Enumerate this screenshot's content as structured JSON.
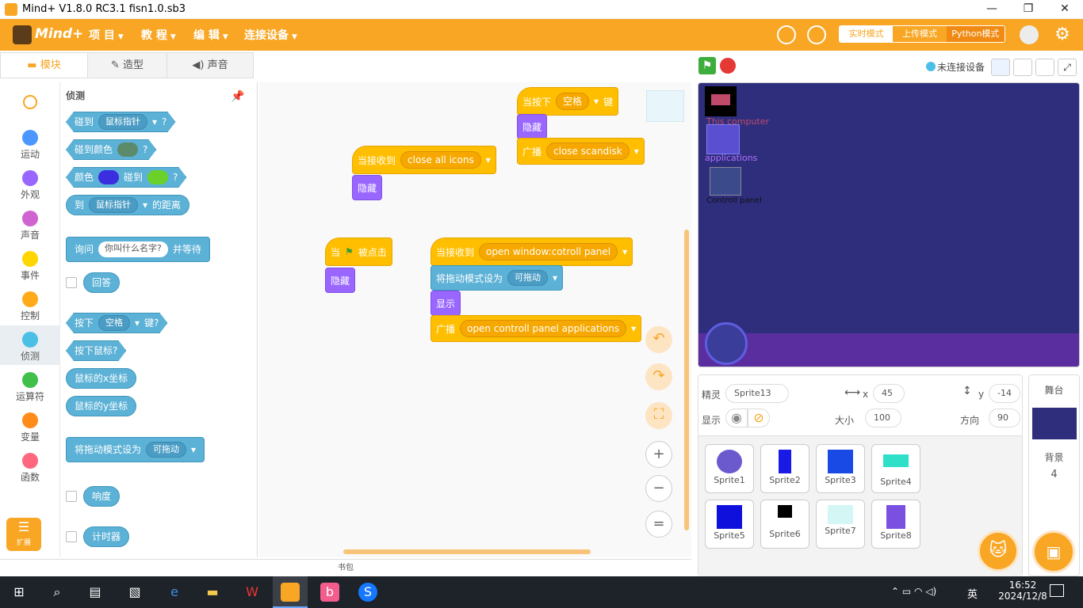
{
  "window": {
    "title": "Mind+ V1.8.0 RC3.1    fisn1.0.sb3",
    "minimize": "—",
    "restore": "❐",
    "close": "✕"
  },
  "menu": {
    "logo": "Mind+",
    "items": [
      "项 目",
      "教 程",
      "编 辑",
      "连接设备"
    ],
    "modes": [
      "实时模式",
      "上传模式",
      "Python模式"
    ]
  },
  "tabs": [
    "模块",
    "造型",
    "声音"
  ],
  "categories": [
    {
      "label": "运动",
      "color": "#4c97ff"
    },
    {
      "label": "外观",
      "color": "#9966ff"
    },
    {
      "label": "声音",
      "color": "#cf63cf"
    },
    {
      "label": "事件",
      "color": "#ffd500"
    },
    {
      "label": "控制",
      "color": "#ffab19"
    },
    {
      "label": "侦测",
      "color": "#4cbfe6"
    },
    {
      "label": "运算符",
      "color": "#40bf4a"
    },
    {
      "label": "变量",
      "color": "#ff8c1a"
    },
    {
      "label": "函数",
      "color": "#ff6680"
    }
  ],
  "extension_label": "扩展",
  "palette": {
    "heading": "侦测",
    "touching": "碰到",
    "mouse_pointer": "鼠标指针",
    "q": "?",
    "touching_color": "碰到颜色",
    "color": "颜色",
    "touch": "碰到",
    "to": "到",
    "distance": "的距离",
    "ask": "询问",
    "ask_default": "你叫什么名字?",
    "and_wait": "并等待",
    "answer": "回答",
    "key_pressed_a": "按下",
    "space": "空格",
    "key_pressed_b": "键?",
    "mouse_down": "按下鼠标?",
    "mouse_x": "鼠标的x坐标",
    "mouse_y": "鼠标的y坐标",
    "set_drag": "将拖动模式设为",
    "draggable": "可拖动",
    "loudness": "响度",
    "timer": "计时器"
  },
  "scripts": {
    "s1": {
      "when_key": "当按下",
      "key": "空格",
      "key_suffix": "键",
      "hide": "隐藏",
      "broadcast": "广播",
      "msg": "close scandisk"
    },
    "s2": {
      "when_receive": "当接收到",
      "msg": "close all icons",
      "hide": "隐藏"
    },
    "s3": {
      "when": "当",
      "clicked": "被点击",
      "hide": "隐藏"
    },
    "s4": {
      "when_receive": "当接收到",
      "msg": "open window:cotroll panel",
      "set_drag": "将拖动模式设为",
      "draggable": "可拖动",
      "show": "显示",
      "broadcast": "广播",
      "msg2": "open controll panel applications"
    }
  },
  "backpack": "书包",
  "stage": {
    "device_status": "未连接设备",
    "icon1": "This computer",
    "icon2": "applications",
    "icon3": "Controll panel"
  },
  "sprite_info": {
    "sprite_label": "精灵",
    "sprite_name": "Sprite13",
    "x_label": "x",
    "x": "45",
    "y_label": "y",
    "y": "-14",
    "show_label": "显示",
    "size_label": "大小",
    "size": "100",
    "dir_label": "方向",
    "dir": "90"
  },
  "sprites": [
    "Sprite1",
    "Sprite2",
    "Sprite3",
    "Sprite4",
    "Sprite5",
    "Sprite6",
    "Sprite7",
    "Sprite8"
  ],
  "stage_panel": {
    "title": "舞台",
    "bg_label": "背景",
    "bg_count": "4"
  },
  "taskbar": {
    "time": "16:52",
    "date": "2024/12/8",
    "ime": "英"
  }
}
